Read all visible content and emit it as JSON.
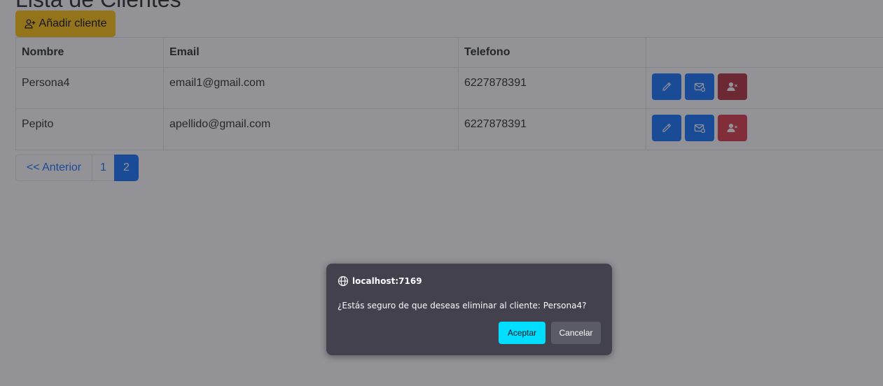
{
  "page": {
    "title": "Lista de Clientes",
    "add_button_label": "Añadir cliente"
  },
  "table": {
    "headers": [
      "Nombre",
      "Email",
      "Telefono",
      ""
    ],
    "rows": [
      {
        "nombre": "Persona4",
        "email": "email1@gmail.com",
        "telefono": "6227878391"
      },
      {
        "nombre": "Pepito",
        "email": "apellido@gmail.com",
        "telefono": "6227878391"
      }
    ],
    "row_actions": [
      "pencil-icon",
      "envelope-icon",
      "person-x-icon"
    ]
  },
  "pagination": {
    "prev_label": "<< Anterior",
    "pages": [
      "1",
      "2"
    ],
    "active_page": "2"
  },
  "dialog": {
    "origin": "localhost:7169",
    "message": "¿Estás seguro de que deseas eliminar al cliente: Persona4?",
    "ok_label": "Aceptar",
    "cancel_label": "Cancelar"
  },
  "colors": {
    "warning": "#ffc107",
    "primary": "#0d6efd",
    "danger": "#dc3545",
    "dialog_bg": "#42414d",
    "dialog_accent": "#00ddff"
  }
}
